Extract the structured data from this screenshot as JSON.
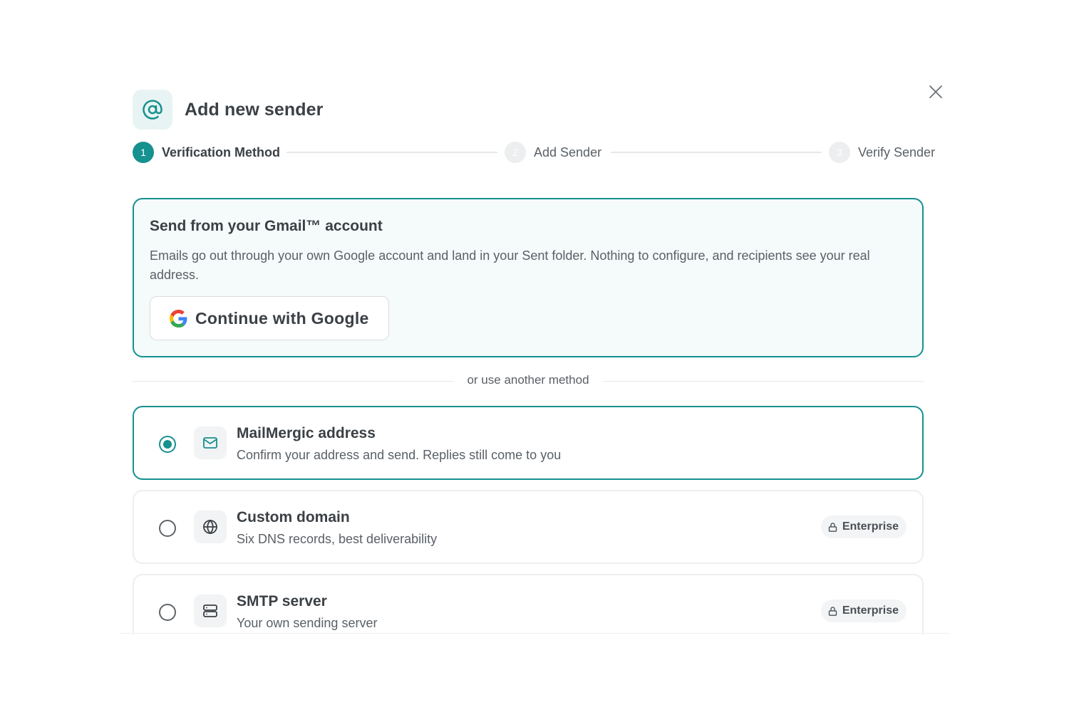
{
  "modal": {
    "title": "Add new sender",
    "header_icon": "at-sign-icon",
    "close_icon": "close-icon"
  },
  "stepper": {
    "steps": [
      {
        "number": "1",
        "label": "Verification Method",
        "state": "active"
      },
      {
        "number": "2",
        "label": "Add Sender",
        "state": "inactive"
      },
      {
        "number": "3",
        "label": "Verify Sender",
        "state": "inactive"
      }
    ]
  },
  "gmail": {
    "title": "Send from your Gmail™ account",
    "description": "Emails go out through your own Google account and land in your Sent folder. Nothing to configure, and recipients see your real address.",
    "button_label": "Continue with Google",
    "button_icon": "google-logo-icon"
  },
  "divider": {
    "text": "or use another method"
  },
  "options": [
    {
      "title": "MailMergic address",
      "description": "Confirm your address and send. Replies still come to you",
      "selected": true,
      "icon": "envelope-icon"
    },
    {
      "title": "Custom domain",
      "description": "Six DNS records, best deliverability",
      "selected": false,
      "icon": "globe-icon",
      "badge": "Enterprise",
      "badge_icon": "lock-icon"
    },
    {
      "title": "SMTP server",
      "description": "Your own sending server",
      "selected": false,
      "icon": "server-icon",
      "badge": "Enterprise",
      "badge_icon": "lock-icon"
    }
  ],
  "colors": {
    "accent": "#15918f",
    "text_primary": "#3b4045",
    "text_secondary": "#5a6066",
    "card_bg": "#f5fafa"
  }
}
